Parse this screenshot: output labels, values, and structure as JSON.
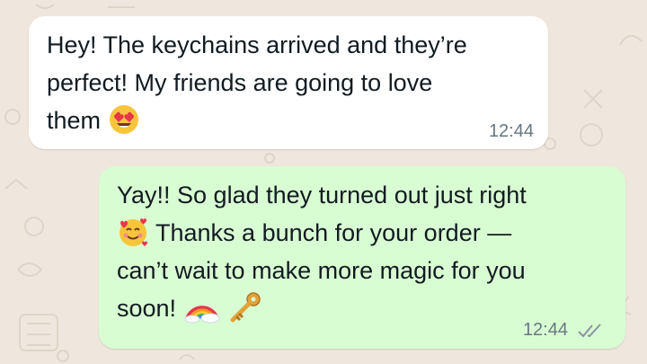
{
  "messages": {
    "incoming": {
      "line1": "Hey! The keychains arrived and they’re",
      "line2": "perfect! My friends are going to love",
      "line3": "them",
      "line3_emoji": "smiling-face-with-heart-eyes",
      "time": "12:44"
    },
    "outgoing": {
      "line1": "Yay!! So glad they turned out just right",
      "line2_emoji": "smiling-face-with-hearts",
      "line2": " Thanks a bunch for your order —",
      "line3": "can’t wait to make more magic for you",
      "line4": "soon!",
      "line4_emojis": [
        "rainbow",
        "key"
      ],
      "time": "12:44",
      "status": "read"
    }
  },
  "colors": {
    "wallpaper": "#efe7dd",
    "incoming_bubble": "#ffffff",
    "outgoing_bubble": "#d9fdd3",
    "meta_text": "#667781"
  }
}
